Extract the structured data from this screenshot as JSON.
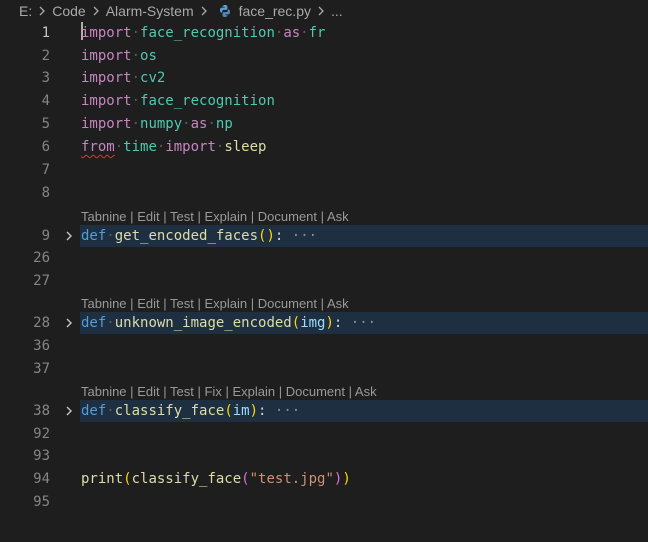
{
  "breadcrumb": {
    "drive": "E:",
    "folder1": "Code",
    "folder2": "Alarm-System",
    "file": "face_rec.py",
    "more": "..."
  },
  "colors": {
    "keyword": "#c586c0",
    "def": "#569cd6",
    "module": "#4ec9b0",
    "function": "#dcdcaa",
    "param": "#9cdcfe",
    "string": "#ce9178",
    "fold_bg": "#1d2f40"
  },
  "lines": {
    "l1": {
      "num": "1",
      "kw": "import",
      "mod": "face_recognition",
      "as": "as",
      "alias": "fr"
    },
    "l2": {
      "num": "2",
      "kw": "import",
      "mod": "os"
    },
    "l3": {
      "num": "3",
      "kw": "import",
      "mod": "cv2"
    },
    "l4": {
      "num": "4",
      "kw": "import",
      "mod": "face_recognition"
    },
    "l5": {
      "num": "5",
      "kw": "import",
      "mod": "numpy",
      "as": "as",
      "alias": "np"
    },
    "l6": {
      "num": "6",
      "from": "from",
      "mod": "time",
      "kw": "import",
      "name": "sleep"
    },
    "l7": {
      "num": "7"
    },
    "l8": {
      "num": "8"
    },
    "l9": {
      "num": "9",
      "def": "def",
      "fn": "get_encoded_faces",
      "open": "(",
      "close": ")",
      "colon": ":",
      "ellipsis": "···"
    },
    "l26": {
      "num": "26"
    },
    "l27": {
      "num": "27"
    },
    "l28": {
      "num": "28",
      "def": "def",
      "fn": "unknown_image_encoded",
      "open": "(",
      "param": "img",
      "close": ")",
      "colon": ":",
      "ellipsis": "···"
    },
    "l36": {
      "num": "36"
    },
    "l37": {
      "num": "37"
    },
    "l38": {
      "num": "38",
      "def": "def",
      "fn": "classify_face",
      "open": "(",
      "param": "im",
      "close": ")",
      "colon": ":",
      "ellipsis": "···"
    },
    "l92": {
      "num": "92"
    },
    "l93": {
      "num": "93"
    },
    "l94": {
      "num": "94",
      "fn1": "print",
      "open1": "(",
      "fn2": "classify_face",
      "open2": "(",
      "str": "\"test.jpg\"",
      "close2": ")",
      "close1": ")"
    },
    "l95": {
      "num": "95"
    }
  },
  "codelens": {
    "first": {
      "items": [
        "Tabnine",
        "Edit",
        "Test",
        "Explain",
        "Document",
        "Ask"
      ]
    },
    "second": {
      "items": [
        "Tabnine",
        "Edit",
        "Test",
        "Explain",
        "Document",
        "Ask"
      ]
    },
    "third": {
      "items": [
        "Tabnine",
        "Edit",
        "Test",
        "Fix",
        "Explain",
        "Document",
        "Ask"
      ]
    },
    "separator": "|"
  }
}
